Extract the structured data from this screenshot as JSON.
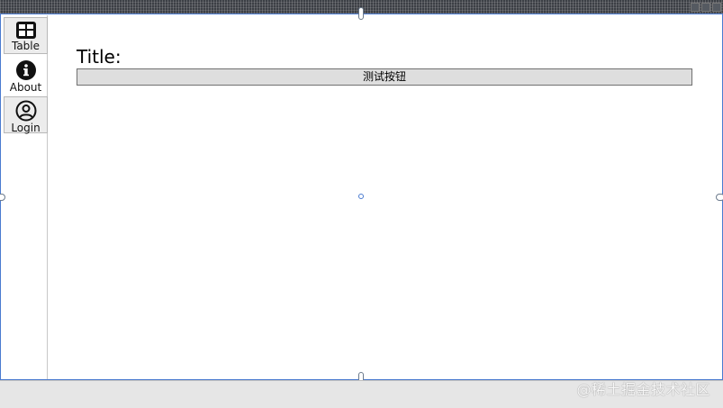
{
  "sidebar": {
    "items": [
      {
        "label": "Table",
        "icon": "table-icon"
      },
      {
        "label": "About",
        "icon": "info-icon"
      },
      {
        "label": "Login",
        "icon": "user-circle-icon"
      }
    ]
  },
  "main": {
    "title": "Title:",
    "test_button_label": "测试按钮"
  },
  "watermark": "@稀土掘金技术社区",
  "colors": {
    "selection_border": "#4a7bd0",
    "button_bg": "#dedede",
    "status_bar_bg": "#e6e6e6"
  }
}
